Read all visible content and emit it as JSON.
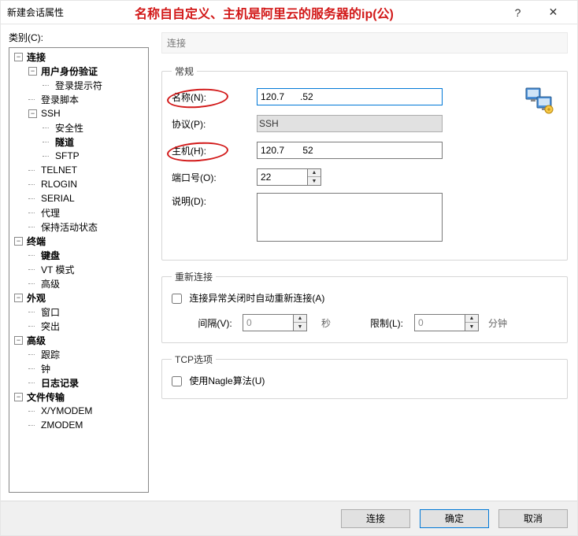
{
  "window": {
    "title": "新建会话属性",
    "annotation": "名称自自定义、主机是阿里云的服务器的ip(公)",
    "help": "?",
    "close": "✕"
  },
  "left": {
    "category_label": "类别(C):",
    "tree": {
      "conn": "连接",
      "auth": "用户身份验证",
      "login_prompt": "登录提示符",
      "login_script": "登录脚本",
      "ssh": "SSH",
      "security": "安全性",
      "tunnel": "隧道",
      "sftp": "SFTP",
      "telnet": "TELNET",
      "rlogin": "RLOGIN",
      "serial": "SERIAL",
      "proxy": "代理",
      "keepalive": "保持活动状态",
      "terminal": "终端",
      "keyboard": "键盘",
      "vt": "VT 模式",
      "advanced_t": "高级",
      "appearance": "外观",
      "window": "窗口",
      "highlight": "突出",
      "advanced": "高级",
      "trace": "跟踪",
      "bell": "钟",
      "log": "日志记录",
      "transfer": "文件传输",
      "xy": "X/YMODEM",
      "zm": "ZMODEM"
    }
  },
  "right": {
    "header": "连接",
    "general": {
      "legend": "常规",
      "name_label": "名称(N):",
      "name_value": "120.7      .52",
      "proto_label": "协议(P):",
      "proto_value": "SSH",
      "host_label": "主机(H):",
      "host_value": "120.7       52",
      "port_label": "端口号(O):",
      "port_value": "22",
      "desc_label": "说明(D):",
      "desc_value": ""
    },
    "reconnect": {
      "legend": "重新连接",
      "chk_label": "连接异常关闭时自动重新连接(A)",
      "interval_label": "间隔(V):",
      "interval_value": "0",
      "interval_unit": "秒",
      "limit_label": "限制(L):",
      "limit_value": "0",
      "limit_unit": "分钟"
    },
    "tcp": {
      "legend": "TCP选项",
      "nagle_label": "使用Nagle算法(U)"
    }
  },
  "footer": {
    "connect": "连接",
    "ok": "确定",
    "cancel": "取消"
  }
}
